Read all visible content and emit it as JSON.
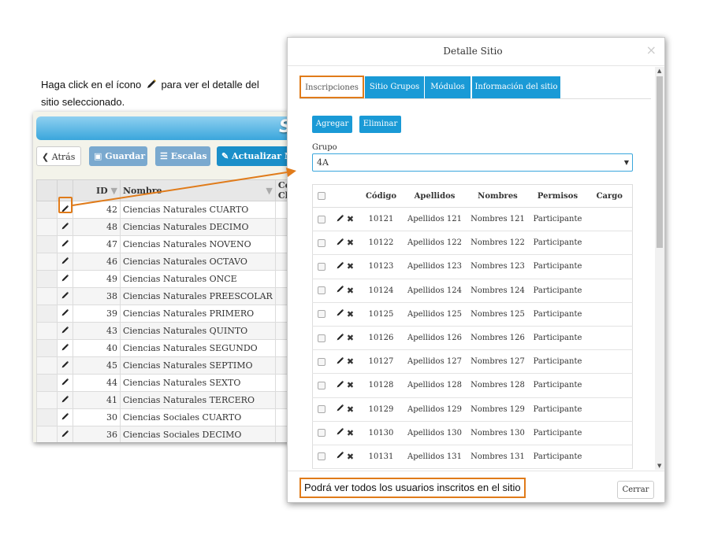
{
  "callout": {
    "before": "Haga click en el ícono",
    "after": "para ver el detalle del",
    "line2": "sitio seleccionado."
  },
  "background_app": {
    "header_title": "SI",
    "toolbar": {
      "back": "Atrás",
      "save": "Guardar",
      "scales": "Escalas",
      "update": "Actualizar Nor"
    },
    "columns": [
      "ID",
      "Nombre",
      "Cód. Cl"
    ],
    "rows": [
      {
        "id": "42",
        "name": "Ciencias Naturales CUARTO"
      },
      {
        "id": "48",
        "name": "Ciencias Naturales DECIMO"
      },
      {
        "id": "47",
        "name": "Ciencias Naturales NOVENO"
      },
      {
        "id": "46",
        "name": "Ciencias Naturales OCTAVO"
      },
      {
        "id": "49",
        "name": "Ciencias Naturales ONCE"
      },
      {
        "id": "38",
        "name": "Ciencias Naturales PREESCOLAR"
      },
      {
        "id": "39",
        "name": "Ciencias Naturales PRIMERO"
      },
      {
        "id": "43",
        "name": "Ciencias Naturales QUINTO"
      },
      {
        "id": "40",
        "name": "Ciencias Naturales SEGUNDO"
      },
      {
        "id": "45",
        "name": "Ciencias Naturales SEPTIMO"
      },
      {
        "id": "44",
        "name": "Ciencias Naturales SEXTO"
      },
      {
        "id": "41",
        "name": "Ciencias Naturales TERCERO"
      },
      {
        "id": "30",
        "name": "Ciencias Sociales CUARTO"
      },
      {
        "id": "36",
        "name": "Ciencias Sociales DECIMO"
      }
    ]
  },
  "modal": {
    "title": "Detalle Sitio",
    "close_icon": "×",
    "tabs": [
      "Inscripciones",
      "Sitio Grupos",
      "Módulos",
      "Información del sitio"
    ],
    "active_tab": "Inscripciones",
    "add_label": "Agregar",
    "delete_label": "Eliminar",
    "group_label": "Grupo",
    "group_value": "4A",
    "columns": [
      "Código",
      "Apellidos",
      "Nombres",
      "Permisos",
      "Cargo"
    ],
    "rows": [
      {
        "code": "10121",
        "last": "Apellidos 121",
        "first": "Nombres 121",
        "perm": "Participante"
      },
      {
        "code": "10122",
        "last": "Apellidos 122",
        "first": "Nombres 122",
        "perm": "Participante"
      },
      {
        "code": "10123",
        "last": "Apellidos 123",
        "first": "Nombres 123",
        "perm": "Participante"
      },
      {
        "code": "10124",
        "last": "Apellidos 124",
        "first": "Nombres 124",
        "perm": "Participante"
      },
      {
        "code": "10125",
        "last": "Apellidos 125",
        "first": "Nombres 125",
        "perm": "Participante"
      },
      {
        "code": "10126",
        "last": "Apellidos 126",
        "first": "Nombres 126",
        "perm": "Participante"
      },
      {
        "code": "10127",
        "last": "Apellidos 127",
        "first": "Nombres 127",
        "perm": "Participante"
      },
      {
        "code": "10128",
        "last": "Apellidos 128",
        "first": "Nombres 128",
        "perm": "Participante"
      },
      {
        "code": "10129",
        "last": "Apellidos 129",
        "first": "Nombres 129",
        "perm": "Participante"
      },
      {
        "code": "10130",
        "last": "Apellidos 130",
        "first": "Nombres 130",
        "perm": "Participante"
      },
      {
        "code": "10131",
        "last": "Apellidos 131",
        "first": "Nombres 131",
        "perm": "Participante"
      }
    ],
    "footer_note": "Podrá ver todos los usuarios inscritos en el sitio",
    "close_button": "Cerrar"
  },
  "colors": {
    "accent": "#1a9ad6",
    "highlight": "#e07b1a"
  }
}
